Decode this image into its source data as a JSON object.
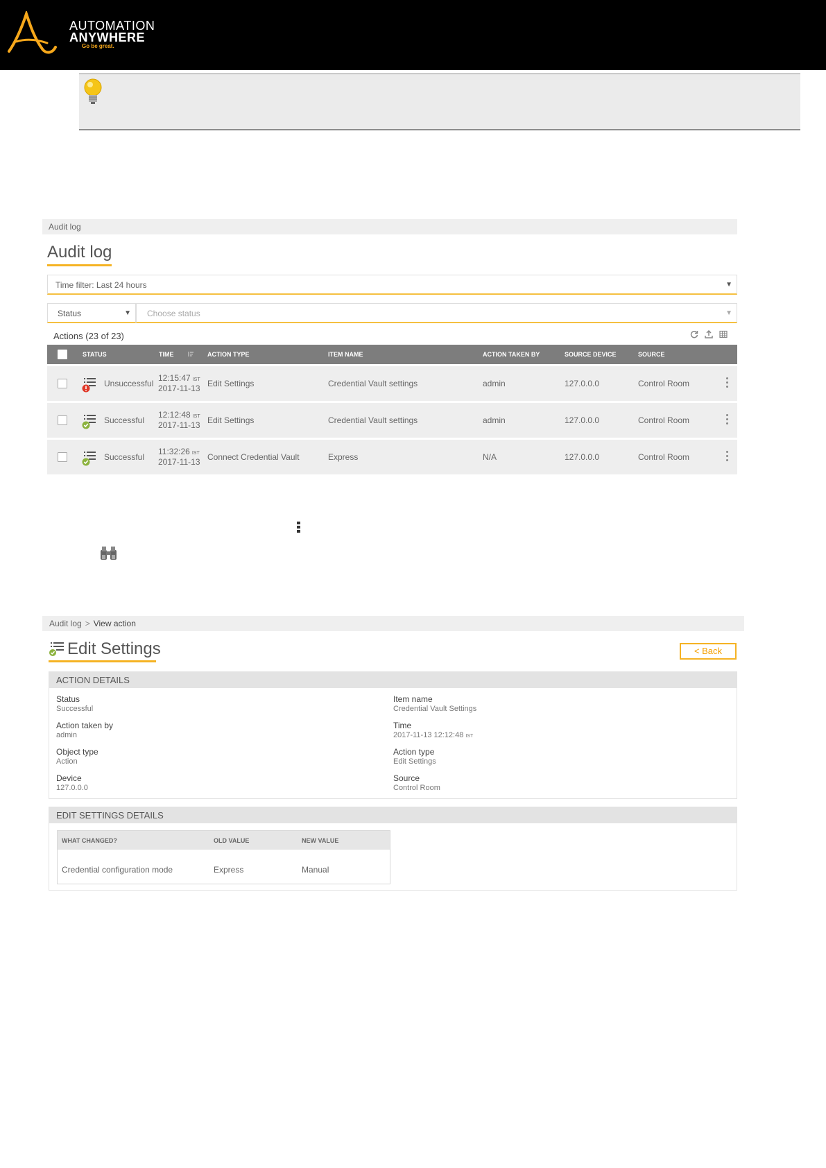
{
  "brand": {
    "line1": "AUTOMATION",
    "line2": "ANYWHERE",
    "tagline": "Go be great.",
    "accent_color": "#f7a81b",
    "header_color": "#000000"
  },
  "tip": {
    "icon": "lightbulb-icon"
  },
  "audit_log": {
    "breadcrumb": "Audit log",
    "title": "Audit log",
    "time_filter": "Time filter: Last 24 hours",
    "status_filter": "Status",
    "status_placeholder": "Choose status",
    "actions_count": "Actions (23 of 23)",
    "toolbar_icons": [
      "refresh-icon",
      "export-icon",
      "columns-icon"
    ],
    "columns": [
      "STATUS",
      "TIME",
      "ACTION TYPE",
      "ITEM NAME",
      "ACTION TAKEN BY",
      "SOURCE DEVICE",
      "SOURCE"
    ],
    "rows": [
      {
        "status": "Unsuccessful",
        "status_icon": "error-icon",
        "time": "12:15:47",
        "tz": "IST",
        "date": "2017-11-13",
        "action_type": "Edit Settings",
        "item_name": "Credential Vault settings",
        "action_taken_by": "admin",
        "source_device": "127.0.0.0",
        "source": "Control Room"
      },
      {
        "status": "Successful",
        "status_icon": "success-icon",
        "time": "12:12:48",
        "tz": "IST",
        "date": "2017-11-13",
        "action_type": "Edit Settings",
        "item_name": "Credential Vault settings",
        "action_taken_by": "admin",
        "source_device": "127.0.0.0",
        "source": "Control Room"
      },
      {
        "status": "Successful",
        "status_icon": "success-icon",
        "time": "11:32:26",
        "tz": "IST",
        "date": "2017-11-13",
        "action_type": "Connect Credential Vault",
        "item_name": "Express",
        "action_taken_by": "N/A",
        "source_device": "127.0.0.0",
        "source": "Control Room"
      }
    ]
  },
  "view_action": {
    "breadcrumb_root": "Audit log",
    "breadcrumb_sep": ">",
    "breadcrumb_current": "View action",
    "title": "Edit Settings",
    "back_label": "< Back",
    "action_details_header": "ACTION DETAILS",
    "details_left": [
      {
        "label": "Status",
        "value": "Successful"
      },
      {
        "label": "Action taken by",
        "value": "admin"
      },
      {
        "label": "Object type",
        "value": "Action"
      },
      {
        "label": "Device",
        "value": "127.0.0.0"
      }
    ],
    "details_right": [
      {
        "label": "Item name",
        "value": "Credential Vault Settings"
      },
      {
        "label": "Time",
        "value": "2017-11-13 12:12:48",
        "tz": "IST"
      },
      {
        "label": "Action type",
        "value": "Edit Settings"
      },
      {
        "label": "Source",
        "value": "Control Room"
      }
    ],
    "edit_settings_header": "EDIT SETTINGS DETAILS",
    "change_columns": [
      "WHAT CHANGED?",
      "OLD VALUE",
      "NEW VALUE"
    ],
    "changes": [
      {
        "what": "Credential configuration mode",
        "old": "Express",
        "new": "Manual"
      }
    ]
  }
}
